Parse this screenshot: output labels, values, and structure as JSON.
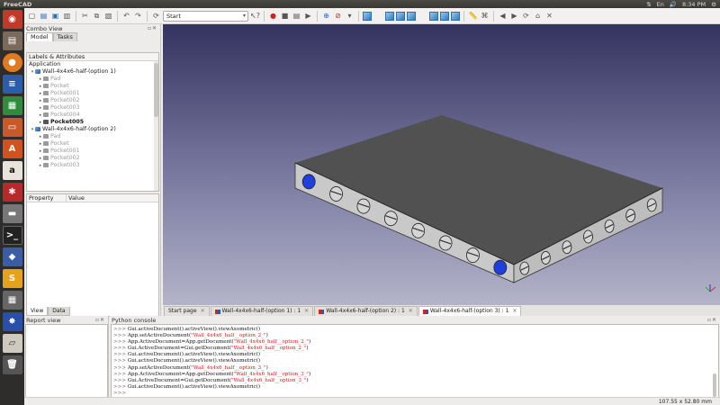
{
  "topbar": {
    "app_name": "FreeCAD",
    "time": "8:34 PM"
  },
  "toolbar": {
    "workbench": "Start",
    "icons": [
      "new-icon",
      "open-icon",
      "save-icon",
      "save-as-icon",
      "cut-icon",
      "copy-icon",
      "paste-icon",
      "undo-icon",
      "redo-icon",
      "refresh-icon",
      "workbench-selector",
      "whats-this-icon",
      "macro-record-icon",
      "macro-stop-icon",
      "macro-editor-icon",
      "macro-run-icon",
      "fit-all-icon",
      "draw-style-icon",
      "isometric-view-icon",
      "front-view-icon",
      "top-view-icon",
      "right-view-icon",
      "rear-view-icon",
      "bottom-view-icon",
      "left-view-icon",
      "measure-icon",
      "link-icon",
      "back-icon",
      "forward-icon",
      "refresh-page-icon",
      "home-icon",
      "stop-icon"
    ]
  },
  "combo": {
    "title": "Combo View",
    "tabs": [
      "Model",
      "Tasks"
    ],
    "tree_header": "Labels & Attributes",
    "tree_root": "Application",
    "rows": [
      {
        "label": "Wall-4x4x6-half-(option 1)",
        "level": 1,
        "kind": "body",
        "style": "normal"
      },
      {
        "label": "Pad",
        "level": 2,
        "kind": "feat",
        "style": "dim"
      },
      {
        "label": "Pocket",
        "level": 2,
        "kind": "feat",
        "style": "dim"
      },
      {
        "label": "Pocket001",
        "level": 2,
        "kind": "feat",
        "style": "dim"
      },
      {
        "label": "Pocket002",
        "level": 2,
        "kind": "feat",
        "style": "dim"
      },
      {
        "label": "Pocket003",
        "level": 2,
        "kind": "feat",
        "style": "dim"
      },
      {
        "label": "Pocket004",
        "level": 2,
        "kind": "feat",
        "style": "dim"
      },
      {
        "label": "Pocket005",
        "level": 2,
        "kind": "feat",
        "style": "bold"
      },
      {
        "label": "Wall-4x4x6-half-(option 2)",
        "level": 1,
        "kind": "body",
        "style": "normal"
      },
      {
        "label": "Pad",
        "level": 2,
        "kind": "feat",
        "style": "dim"
      },
      {
        "label": "Pocket",
        "level": 2,
        "kind": "feat",
        "style": "dim"
      },
      {
        "label": "Pocket001",
        "level": 2,
        "kind": "feat",
        "style": "dim"
      },
      {
        "label": "Pocket002",
        "level": 2,
        "kind": "feat",
        "style": "dim"
      },
      {
        "label": "Pocket003",
        "level": 2,
        "kind": "feat",
        "style": "dim"
      }
    ],
    "prop_col_property": "Property",
    "prop_col_value": "Value",
    "view_tabs": [
      "View",
      "Data"
    ]
  },
  "doc_tabs": [
    {
      "label": "Start page",
      "active": false,
      "icon": false
    },
    {
      "label": "Wall-4x4x6-half-(option 1) : 1",
      "active": false,
      "icon": true
    },
    {
      "label": "Wall-4x4x6-half-(option 2) : 1",
      "active": false,
      "icon": true
    },
    {
      "label": "Wall-4x4x6-half-(option 3) : 1",
      "active": true,
      "icon": true
    }
  ],
  "report": {
    "title": "Report view"
  },
  "python": {
    "title": "Python console",
    "lines": [
      [
        {
          "t": "pr",
          "s": ">>> "
        },
        {
          "t": "cm",
          "s": "Gui.activeDocument().activeView().viewAxometric()"
        }
      ],
      [
        {
          "t": "pr",
          "s": ">>> "
        },
        {
          "t": "cm",
          "s": "App.setActiveDocument("
        },
        {
          "t": "st",
          "s": "\"Wall_4x4x6_half__option_2_\""
        },
        {
          "t": "cm",
          "s": ")"
        }
      ],
      [
        {
          "t": "pr",
          "s": ">>> "
        },
        {
          "t": "cm",
          "s": "App.ActiveDocument=App.getDocument("
        },
        {
          "t": "st",
          "s": "\"Wall_4x4x6_half__option_2_\""
        },
        {
          "t": "cm",
          "s": ")"
        }
      ],
      [
        {
          "t": "pr",
          "s": ">>> "
        },
        {
          "t": "cm",
          "s": "Gui.ActiveDocument=Gui.getDocument("
        },
        {
          "t": "st",
          "s": "\"Wall_4x4x6_half__option_2_\""
        },
        {
          "t": "cm",
          "s": ")"
        }
      ],
      [
        {
          "t": "pr",
          "s": ">>> "
        },
        {
          "t": "cm",
          "s": "Gui.activeDocument().activeView().viewAxometric()"
        }
      ],
      [
        {
          "t": "pr",
          "s": ">>> "
        },
        {
          "t": "cm",
          "s": "Gui.activeDocument().activeView().viewAxometric()"
        }
      ],
      [
        {
          "t": "pr",
          "s": ">>> "
        },
        {
          "t": "cm",
          "s": "App.setActiveDocument("
        },
        {
          "t": "st",
          "s": "\"Wall_4x4x6_half__option_3_\""
        },
        {
          "t": "cm",
          "s": ")"
        }
      ],
      [
        {
          "t": "pr",
          "s": ">>> "
        },
        {
          "t": "cm",
          "s": "App.ActiveDocument=App.getDocument("
        },
        {
          "t": "st",
          "s": "\"Wall_4x4x6_half__option_3_\""
        },
        {
          "t": "cm",
          "s": ")"
        }
      ],
      [
        {
          "t": "pr",
          "s": ">>> "
        },
        {
          "t": "cm",
          "s": "Gui.ActiveDocument=Gui.getDocument("
        },
        {
          "t": "st",
          "s": "\"Wall_4x4x6_half__option_3_\""
        },
        {
          "t": "cm",
          "s": ")"
        }
      ],
      [
        {
          "t": "pr",
          "s": ">>> "
        },
        {
          "t": "cm",
          "s": "Gui.activeDocument().activeView().viewAxometric()"
        }
      ],
      [
        {
          "t": "pr",
          "s": ">>> "
        }
      ],
      [
        {
          "t": "pr",
          "s": ">>> "
        }
      ]
    ]
  },
  "status": {
    "dimensions": "107.55 x 52.80 mm"
  },
  "colors": {
    "view_top": "#33335f",
    "view_bottom": "#b3b3c9",
    "hole_selected": "#1f3fe0"
  }
}
